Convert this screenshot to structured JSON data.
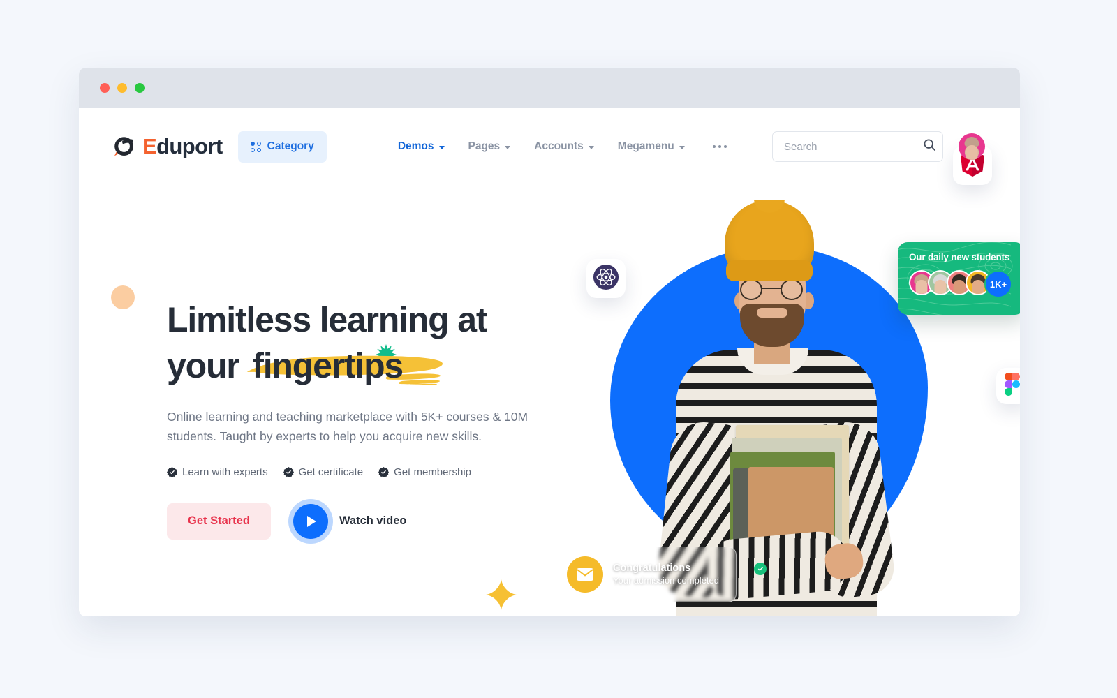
{
  "window": {
    "traffic_lights": [
      "close",
      "minimize",
      "maximize"
    ]
  },
  "navbar": {
    "logo": {
      "text_prefix": "E",
      "text_rest": "duport",
      "icon": "eduport-e-logo-icon"
    },
    "category_button": {
      "label": "Category",
      "icon": "grid-dots-icon"
    },
    "menu": [
      {
        "label": "Demos",
        "active": true,
        "has_caret": true
      },
      {
        "label": "Pages",
        "active": false,
        "has_caret": true
      },
      {
        "label": "Accounts",
        "active": false,
        "has_caret": true
      },
      {
        "label": "Megamenu",
        "active": false,
        "has_caret": true
      }
    ],
    "more_icon": "ellipsis-icon",
    "search": {
      "placeholder": "Search",
      "value": "",
      "icon": "search-icon"
    },
    "avatar": {
      "icon": "user-avatar"
    }
  },
  "hero": {
    "headline_line1": "Limitless learning at",
    "headline_line2_prefix": "your ",
    "headline_highlight": "fingertips",
    "subtext": "Online learning and teaching marketplace with 5K+ courses & 10M students. Taught by experts to help you acquire new skills.",
    "features": [
      {
        "label": "Learn with experts",
        "icon": "badge-check-icon"
      },
      {
        "label": "Get certificate",
        "icon": "badge-check-icon"
      },
      {
        "label": "Get membership",
        "icon": "badge-check-icon"
      }
    ],
    "primary_cta": "Get Started",
    "video_cta": {
      "label": "Watch video",
      "icon": "play-icon"
    },
    "decorations": {
      "orange_circle": "circle-decoration",
      "green_sparkle": "sparkle-icon",
      "yellow_star": "four-point-star-icon"
    }
  },
  "visual": {
    "blob_color": "#0d6efd",
    "badges": [
      {
        "name": "react-logo-icon",
        "color": "#3b3466"
      },
      {
        "name": "angular-logo-icon",
        "color": "#dd0031"
      },
      {
        "name": "figma-logo-icon",
        "color": "#ff7262"
      }
    ],
    "students_card": {
      "title": "Our daily new students",
      "count_badge": "1K+",
      "background": "#16b97e",
      "avatars": [
        "student-avatar-1",
        "student-avatar-2",
        "student-avatar-3",
        "student-avatar-4"
      ]
    },
    "congrats_card": {
      "title": "Congratulations",
      "subtitle": "Your admission completed",
      "mail_icon": "envelope-icon",
      "check_icon": "check-circle-icon",
      "mail_color": "#f5bb2a",
      "check_color": "#17c07c"
    }
  },
  "colors": {
    "brand_blue": "#0d6efd",
    "accent_orange": "#f4622f",
    "highlight_yellow": "#f5c137",
    "cta_red": "#e8334c",
    "page_bg": "#f4f7fc"
  }
}
